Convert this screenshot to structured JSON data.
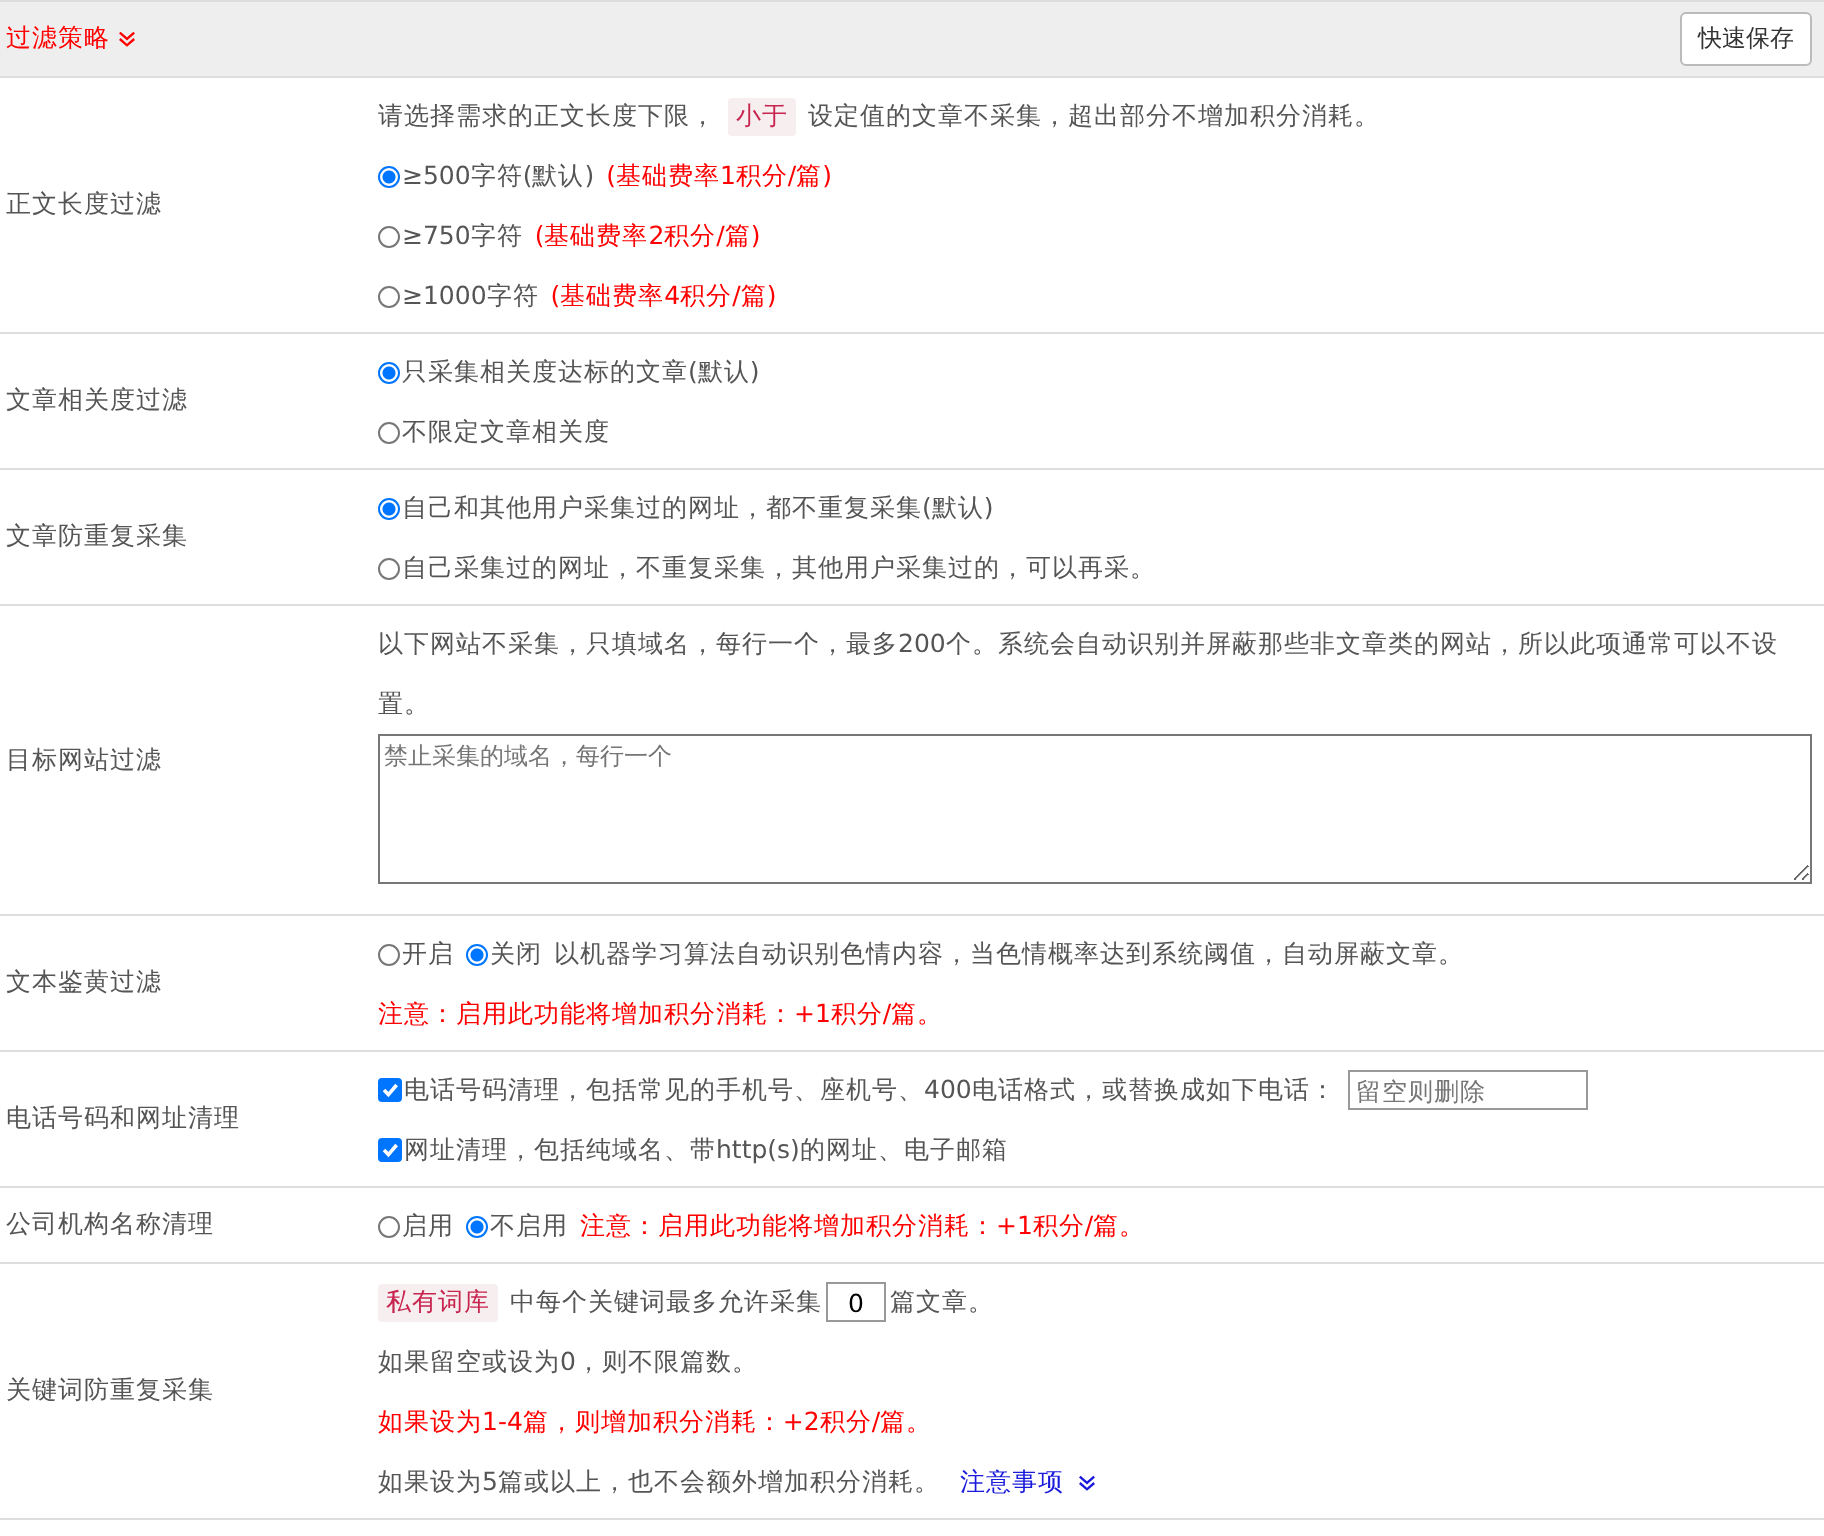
{
  "header": {
    "title": "过滤策略",
    "button": "快速保存"
  },
  "rows": [
    {
      "label": "正文长度过滤",
      "lines": [
        [
          {
            "kind": "text",
            "text": "请选择需求的正文长度下限，"
          },
          {
            "kind": "tag",
            "text": "小于"
          },
          {
            "kind": "text",
            "text": "设定值的文章不采集，超出部分不增加积分消耗。"
          }
        ],
        [
          {
            "kind": "radio",
            "text": "≥500字符(默认)",
            "selected": true
          },
          {
            "kind": "note",
            "text": "(基础费率1积分/篇)"
          }
        ],
        [
          {
            "kind": "radio",
            "text": "≥750字符",
            "selected": false
          },
          {
            "kind": "note",
            "text": "(基础费率2积分/篇)"
          }
        ],
        [
          {
            "kind": "radio",
            "text": "≥1000字符",
            "selected": false
          },
          {
            "kind": "note",
            "text": "(基础费率4积分/篇)"
          }
        ]
      ]
    },
    {
      "label": "文章相关度过滤",
      "lines": [
        [
          {
            "kind": "radio",
            "text": "只采集相关度达标的文章(默认)",
            "selected": true
          }
        ],
        [
          {
            "kind": "radio",
            "text": "不限定文章相关度",
            "selected": false
          }
        ]
      ]
    },
    {
      "label": "文章防重复采集",
      "lines": [
        [
          {
            "kind": "radio",
            "text": "自己和其他用户采集过的网址，都不重复采集(默认)",
            "selected": true
          }
        ],
        [
          {
            "kind": "radio",
            "text": "自己采集过的网址，不重复采集，其他用户采集过的，可以再采。",
            "selected": false
          }
        ]
      ]
    },
    {
      "label": "目标网站过滤",
      "lines": [
        [
          {
            "kind": "text",
            "text": "以下网站不采集，只填域名，每行一个，最多200个。系统会自动识别并屏蔽那些非文章类的网站，所以此项通常可以不设置。"
          }
        ],
        [
          {
            "kind": "textarea",
            "placeholder": "禁止采集的域名，每行一个"
          }
        ]
      ]
    },
    {
      "label": "文本鉴黄过滤",
      "lines": [
        [
          {
            "kind": "radio",
            "text": "开启",
            "selected": false
          },
          {
            "kind": "radio",
            "text": "关闭",
            "selected": true
          },
          {
            "kind": "text",
            "text": "以机器学习算法自动识别色情内容，当色情概率达到系统阈值，自动屏蔽文章。"
          }
        ],
        [
          {
            "kind": "note",
            "text": "注意：启用此功能将增加积分消耗：+1积分/篇。"
          }
        ]
      ]
    },
    {
      "label": "电话号码和网址清理",
      "lines": [
        [
          {
            "kind": "checkbox",
            "text": "电话号码清理，包括常见的手机号、座机号、400电话格式，或替换成如下电话：",
            "checked": true
          },
          {
            "kind": "input",
            "placeholder": "留空则删除"
          }
        ],
        [
          {
            "kind": "checkbox",
            "text": "网址清理，包括纯域名、带http(s)的网址、电子邮箱",
            "checked": true
          }
        ]
      ]
    },
    {
      "label": "公司机构名称清理",
      "lines": [
        [
          {
            "kind": "radio",
            "text": "启用",
            "selected": false
          },
          {
            "kind": "radio",
            "text": "不启用",
            "selected": true
          },
          {
            "kind": "note",
            "text": "注意：启用此功能将增加积分消耗：+1积分/篇。"
          }
        ]
      ]
    },
    {
      "label": "关键词防重复采集",
      "lines": [
        [
          {
            "kind": "tag",
            "text": "私有词库"
          },
          {
            "kind": "text",
            "text": "中每个关键词最多允许采集"
          },
          {
            "kind": "number",
            "value": "0"
          },
          {
            "kind": "text",
            "text": "篇文章。"
          }
        ],
        [
          {
            "kind": "text",
            "text": "如果留空或设为0，则不限篇数。"
          }
        ],
        [
          {
            "kind": "note",
            "text": "如果设为1-4篇，则增加积分消耗：+2积分/篇。"
          }
        ],
        [
          {
            "kind": "text",
            "text": "如果设为5篇或以上，也不会额外增加积分消耗。"
          },
          {
            "kind": "link",
            "text": "注意事项"
          }
        ]
      ]
    }
  ]
}
